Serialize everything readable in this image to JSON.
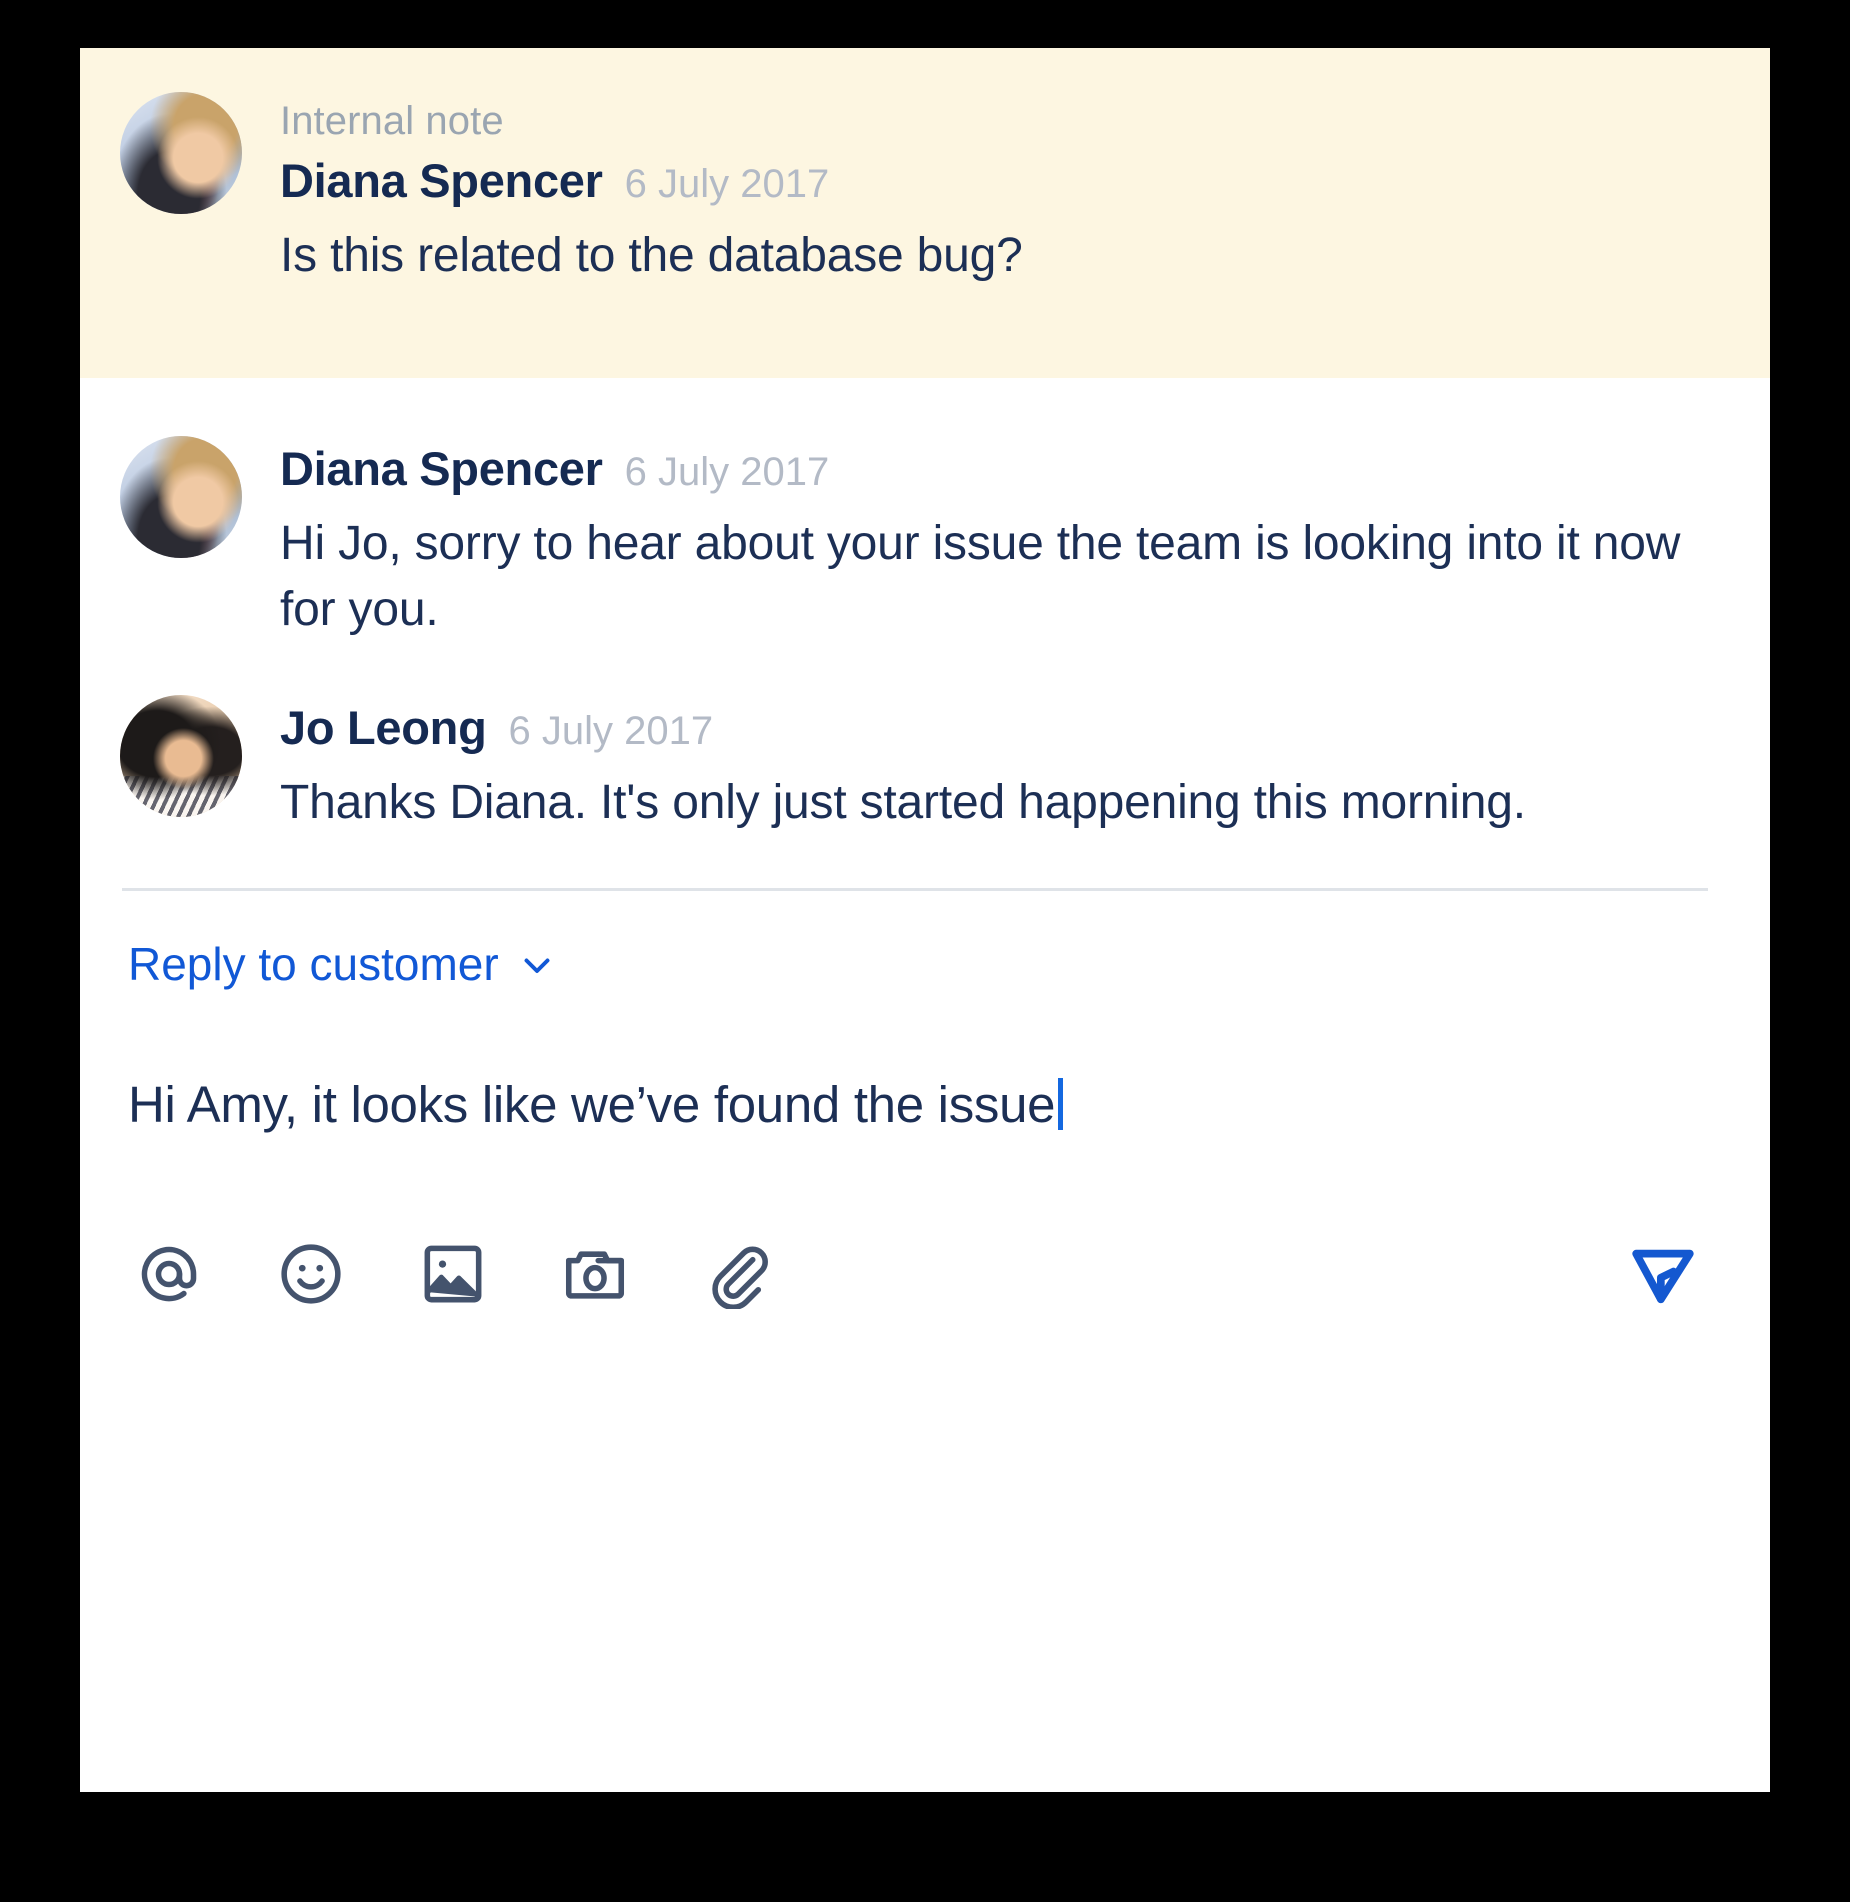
{
  "theme": {
    "note_background": "#fdf6e1",
    "card_background": "#ffffff",
    "page_background": "#000000",
    "name_color": "#152a52",
    "body_color": "#1c2f55",
    "muted_color": "#b3bac6",
    "label_color": "#9aa5b1",
    "accent_blue": "#1158d6",
    "send_blue": "#1458d0",
    "icon_color": "#44536d",
    "divider_color": "#dfe3e8"
  },
  "internal_note": {
    "label": "Internal note",
    "author": "Diana Spencer",
    "timestamp": "6 July 2017",
    "body": "Is this related to the database bug?",
    "avatar": "diana-avatar"
  },
  "messages": [
    {
      "author": "Diana Spencer",
      "timestamp": "6 July 2017",
      "body": "Hi Jo, sorry to hear about your issue the team is looking into it now for you.",
      "avatar": "diana-avatar"
    },
    {
      "author": "Jo Leong",
      "timestamp": "6 July 2017",
      "body": "Thanks Diana. It's only just started happening this morning.",
      "avatar": "jo-avatar"
    }
  ],
  "reply": {
    "mode_label": "Reply to customer",
    "mode_chevron": "chevron-down-icon",
    "draft_text": "Hi Amy, it looks like we’ve found the issue",
    "toolbar": [
      {
        "name": "mention-icon",
        "label": "@"
      },
      {
        "name": "emoji-icon",
        "label": "Emoji"
      },
      {
        "name": "image-icon",
        "label": "Image"
      },
      {
        "name": "camera-icon",
        "label": "Camera"
      },
      {
        "name": "attachment-icon",
        "label": "Attachment"
      }
    ],
    "send": {
      "name": "send-icon",
      "label": "Send"
    }
  }
}
